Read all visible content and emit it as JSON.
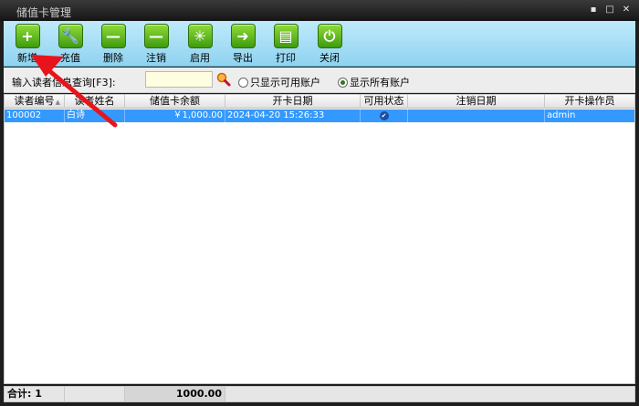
{
  "window": {
    "title": "储值卡管理",
    "controls": [
      "▪",
      "□",
      "✕"
    ]
  },
  "toolbar": {
    "items": [
      {
        "label": "新增",
        "icon": "+"
      },
      {
        "label": "充值",
        "icon": "🔧"
      },
      {
        "label": "删除",
        "icon": "—"
      },
      {
        "label": "注销",
        "icon": "—"
      },
      {
        "label": "启用",
        "icon": "✳"
      },
      {
        "label": "导出",
        "icon": "➜"
      },
      {
        "label": "打印",
        "icon": "▤"
      },
      {
        "label": "关闭",
        "icon": "⏻"
      }
    ]
  },
  "search": {
    "label": "输入读者信息查询[F3]:",
    "value": "",
    "radio_available": "只显示可用账户",
    "radio_all": "显示所有账户",
    "selected": "all"
  },
  "table": {
    "columns": [
      "读者编号",
      "读者姓名",
      "储值卡余额",
      "开卡日期",
      "可用状态",
      "注销日期",
      "开卡操作员"
    ],
    "rows": [
      {
        "id": "100002",
        "name": "白诗",
        "balance": "￥1,000.00",
        "date": "2024-04-20 15:26:33",
        "status": "✔",
        "cancel_date": "",
        "operator": "admin"
      }
    ]
  },
  "footer": {
    "count_label": "合计: 1",
    "total": "1000.00"
  },
  "colors": {
    "toolbar": "#a8e0f6",
    "selection": "#3399ff",
    "annotation_arrow": "#e8141b"
  }
}
